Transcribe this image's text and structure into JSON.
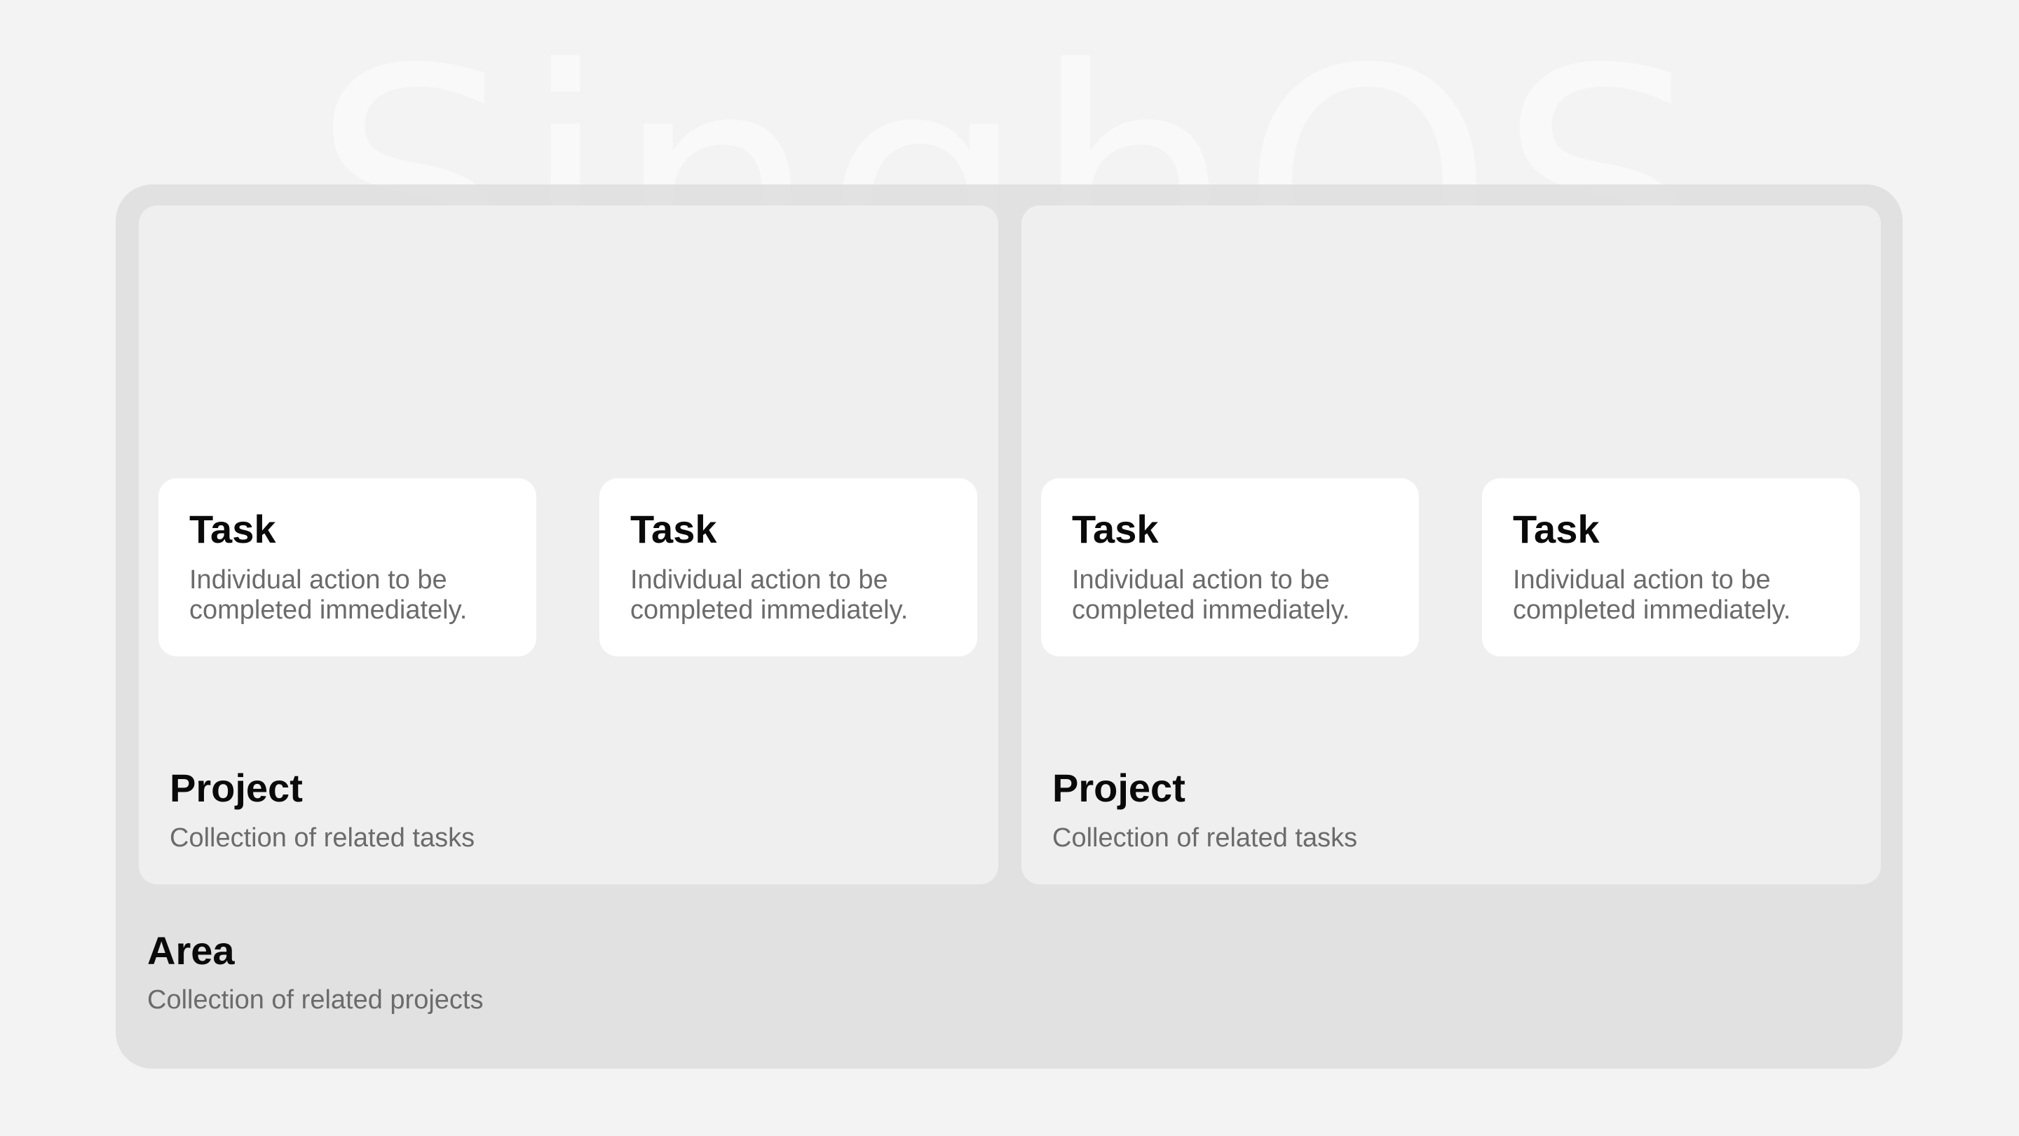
{
  "watermark": "SinghOS",
  "area": {
    "title": "Area",
    "description": "Collection of related projects",
    "projects": [
      {
        "title": "Project",
        "description": "Collection of related tasks",
        "tasks": [
          {
            "title": "Task",
            "description": "Individual action to be completed immediately."
          },
          {
            "title": "Task",
            "description": "Individual action to be completed immediately."
          }
        ]
      },
      {
        "title": "Project",
        "description": "Collection of related tasks",
        "tasks": [
          {
            "title": "Task",
            "description": "Individual action to be completed immediately."
          },
          {
            "title": "Task",
            "description": "Individual action to be completed immediately."
          }
        ]
      }
    ]
  },
  "colors": {
    "background": "#f3f3f3",
    "area": "#dedede",
    "project": "#f0f0f0",
    "task": "#ffffff",
    "title_text": "#0a0a0a",
    "description_text": "#6b6b6b"
  }
}
